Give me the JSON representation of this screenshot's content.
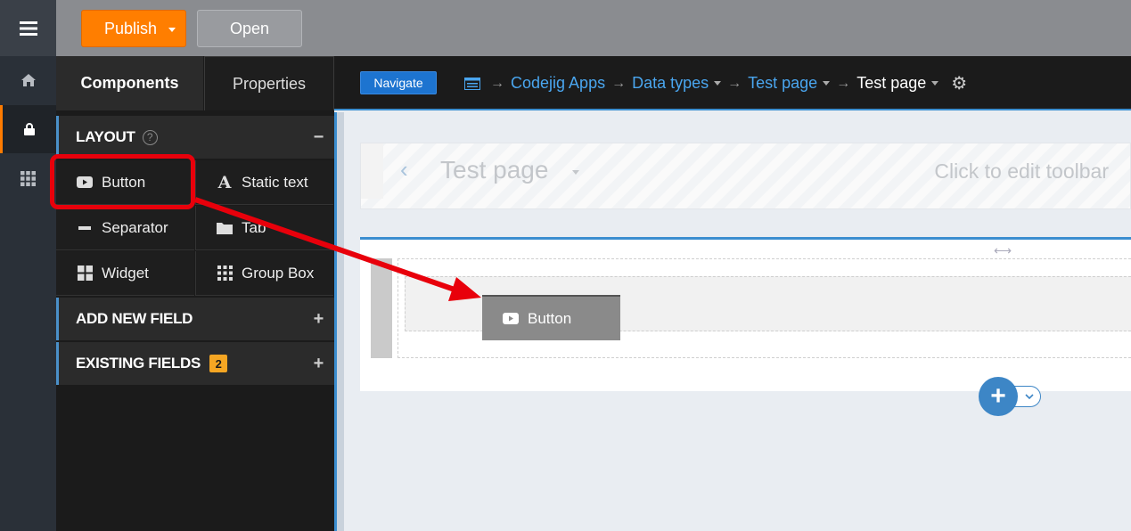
{
  "topbar": {
    "publish_label": "Publish",
    "open_label": "Open"
  },
  "rail": {
    "icons": [
      "menu-icon",
      "home-icon",
      "lock-icon",
      "apps-grid-icon"
    ],
    "active_index": 2
  },
  "panel": {
    "tabs": [
      "Components",
      "Properties"
    ],
    "active_tab": "Components",
    "sections": {
      "layout": "LAYOUT",
      "add_new_field": "ADD NEW FIELD",
      "existing_fields": "EXISTING FIELDS",
      "existing_fields_count": "2"
    },
    "components": [
      {
        "label": "Button",
        "icon": "youtube-play-icon"
      },
      {
        "label": "Static text",
        "icon": "font-a-icon"
      },
      {
        "label": "Separator",
        "icon": "minus-icon"
      },
      {
        "label": "Tab",
        "icon": "folder-icon"
      },
      {
        "label": "Widget",
        "icon": "widget-grid-icon"
      },
      {
        "label": "Group Box",
        "icon": "dots-grid-icon"
      }
    ]
  },
  "breadcrumb": {
    "navigate_label": "Navigate",
    "items": [
      "Codejig Apps",
      "Data types",
      "Test page",
      "Test page"
    ]
  },
  "canvas": {
    "page_title": "Test page",
    "toolbar_hint": "Click to edit toolbar",
    "drag_label": "Button"
  },
  "colors": {
    "accent_orange": "#ff7e00",
    "link_blue": "#4aa6ef",
    "highlight_red": "#e8000b",
    "badge_yellow": "#f5a623"
  }
}
